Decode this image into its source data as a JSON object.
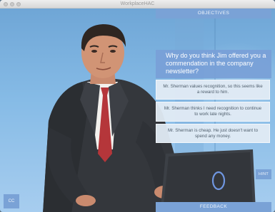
{
  "window": {
    "title": "WorkplaceHAC"
  },
  "toolbar": {
    "objectives_label": "OBJECTIVES",
    "hint_label": "HINT",
    "cc_label": "CC",
    "feedback_label": "FEEDBACK"
  },
  "question": {
    "text": "Why do you think Jim offered you a commendation in the company newsletter?"
  },
  "answers": [
    {
      "text": "Mr. Sherman values recognition, so this seems like a reward to him."
    },
    {
      "text": "Mr. Sherman thinks I need recognition to continue to work late nights."
    },
    {
      "text": "Mr. Sherman is cheap. He just doesn't want to spend any money."
    }
  ],
  "colors": {
    "accent": "#7aa2d6",
    "background": "#86bbe6",
    "answer_bg": "#e2ebf4",
    "answer_text": "#4f5e6c"
  },
  "icons": {
    "laptop_logo": "ring-logo-icon"
  }
}
